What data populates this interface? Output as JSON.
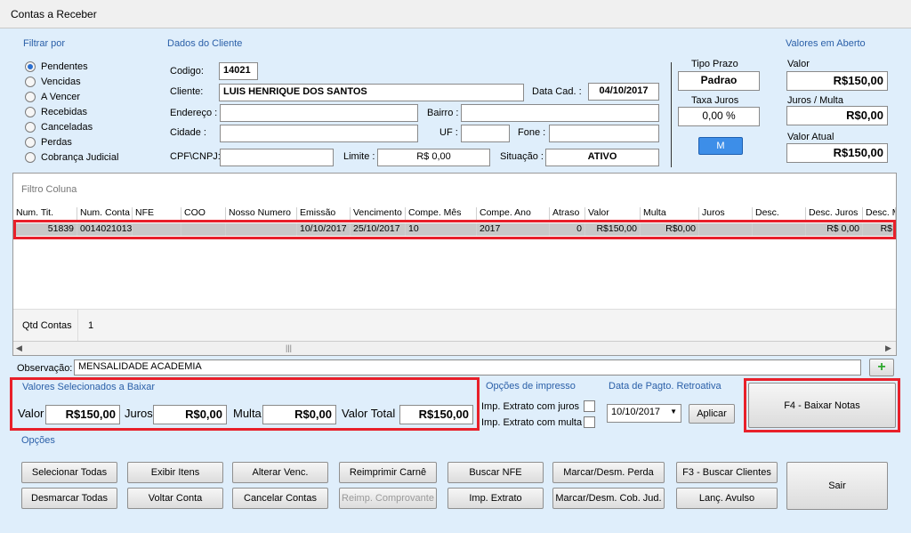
{
  "window": {
    "title": "Contas a Receber"
  },
  "filter": {
    "title": "Filtrar por",
    "options": [
      "Pendentes",
      "Vencidas",
      "A Vencer",
      "Recebidas",
      "Canceladas",
      "Perdas",
      "Cobrança Judicial"
    ],
    "selected_index": 0
  },
  "client": {
    "title": "Dados do Cliente",
    "codigo_label": "Codigo:",
    "codigo": "14021",
    "cliente_label": "Cliente:",
    "cliente": "LUIS HENRIQUE DOS SANTOS",
    "data_cad_label": "Data Cad. :",
    "data_cad": "04/10/2017",
    "endereco_label": "Endereço :",
    "endereco": "",
    "bairro_label": "Bairro :",
    "bairro": "",
    "cidade_label": "Cidade :",
    "cidade": "",
    "uf_label": "UF :",
    "uf": "",
    "fone_label": "Fone :",
    "fone": "",
    "cpf_label": "CPF\\CNPJ:",
    "cpf": "",
    "limite_label": "Limite :",
    "limite": "R$ 0,00",
    "situacao_label": "Situação :",
    "situacao": "ATIVO"
  },
  "prazo": {
    "tipo_label": "Tipo Prazo",
    "tipo": "Padrao",
    "taxa_label": "Taxa Juros",
    "taxa": "0,00 %",
    "m_button": "M"
  },
  "aberto": {
    "title": "Valores em Aberto",
    "valor_label": "Valor",
    "valor": "R$150,00",
    "juros_label": "Juros / Multa",
    "juros": "R$0,00",
    "atual_label": "Valor Atual",
    "atual": "R$150,00"
  },
  "grid": {
    "filter_label": "Filtro Coluna",
    "columns": [
      "Num. Tit.",
      "Num. Conta",
      "NFE",
      "COO",
      "Nosso Numero",
      "Emissão",
      "Vencimento",
      "Compe. Mês",
      "Compe. Ano",
      "Atraso",
      "Valor",
      "Multa",
      "Juros",
      "Desc.",
      "Desc. Juros",
      "Desc. M"
    ],
    "rows": [
      [
        "51839",
        "0014021013",
        "",
        "",
        "",
        "10/10/2017",
        "25/10/2017",
        "10",
        "2017",
        "0",
        "R$150,00",
        "R$0,00",
        "",
        "",
        "R$ 0,00",
        "R$"
      ]
    ],
    "qtd_label": "Qtd Contas",
    "qtd": "1"
  },
  "observacao": {
    "label": "Observação:",
    "value": "MENSALIDADE ACADEMIA",
    "add_icon": "plus-icon"
  },
  "selecionados": {
    "title": "Valores Selecionados a Baixar",
    "valor_label": "Valor",
    "valor": "R$150,00",
    "juros_label": "Juros",
    "juros": "R$0,00",
    "multa_label": "Multa",
    "multa": "R$0,00",
    "total_label": "Valor Total",
    "total": "R$150,00"
  },
  "impresso": {
    "title": "Opções de impresso",
    "juros_label": "Imp. Extrato com juros",
    "multa_label": "Imp. Extrato com multa"
  },
  "retroativa": {
    "title": "Data de Pagto. Retroativa",
    "date": "10/10/2017",
    "apply": "Aplicar"
  },
  "baixar": "F4 - Baixar Notas",
  "opcoes": {
    "title": "Opções",
    "buttons": [
      "Selecionar Todas",
      "Desmarcar Todas",
      "Exibir Itens",
      "Voltar Conta",
      "Alterar Venc.",
      "Cancelar Contas",
      "Reimprimir Carnê",
      "Reimp. Comprovante",
      "Buscar NFE",
      "Imp. Extrato",
      "Marcar/Desm. Perda",
      "Marcar/Desm. Cob. Jud.",
      "F3 - Buscar Clientes",
      "Lanç. Avulso",
      "Sair"
    ]
  },
  "colors": {
    "accent": "#2a5fa8",
    "highlight": "#e8202a",
    "m_button": "#3d8ee8"
  }
}
